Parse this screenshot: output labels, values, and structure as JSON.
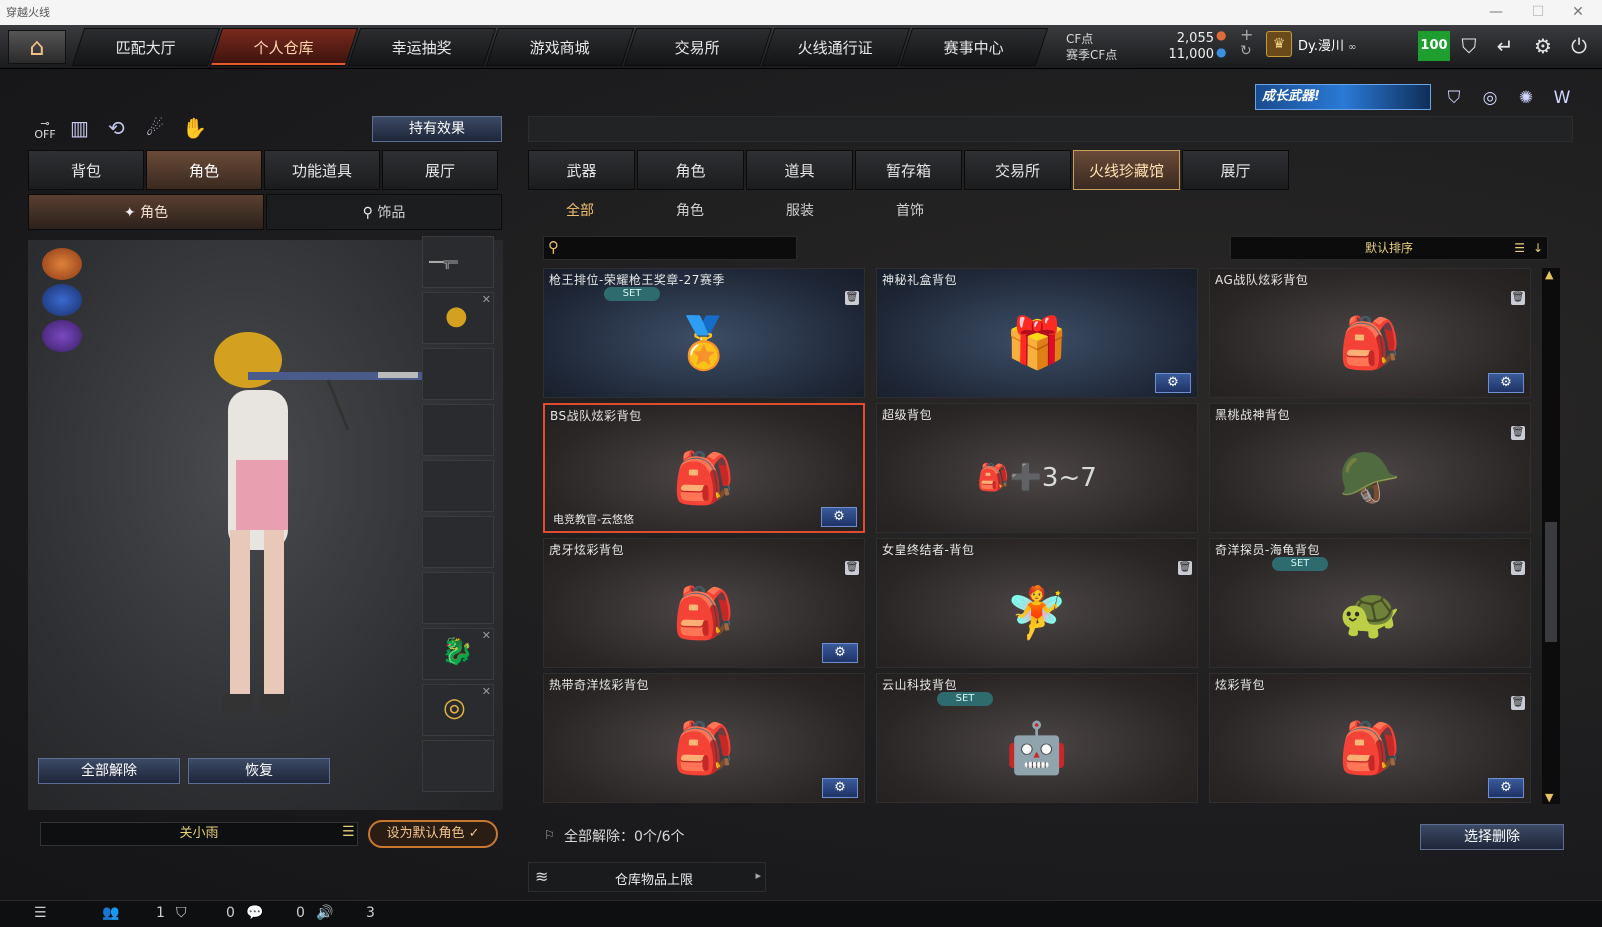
{
  "window": {
    "title": "穿越火线"
  },
  "nav": {
    "tabs": [
      "匹配大厅",
      "个人仓库",
      "幸运抽奖",
      "游戏商城",
      "交易所",
      "火线通行证",
      "赛事中心"
    ],
    "active": 1
  },
  "currency": {
    "cf_label": "CF点",
    "cf_value": "2,055",
    "season_label": "赛季CF点",
    "season_value": "11,000"
  },
  "user": {
    "name": "Dy.漫川",
    "level": "100"
  },
  "banner": {
    "text": "成长武器!"
  },
  "left": {
    "effect_button": "持有效果",
    "tabs": [
      "背包",
      "角色",
      "功能道具",
      "展厅"
    ],
    "active_tab": 1,
    "subtabs": [
      "角色",
      "饰品"
    ],
    "active_subtab": 0,
    "release_all": "全部解除",
    "restore": "恢复",
    "character_name": "关小雨",
    "set_default": "设为默认角色"
  },
  "right": {
    "tabs": [
      "武器",
      "角色",
      "道具",
      "暂存箱",
      "交易所",
      "火线珍藏馆",
      "展厅"
    ],
    "active_tab": 5,
    "filters": [
      "全部",
      "角色",
      "服装",
      "首饰"
    ],
    "active_filter": 0,
    "search": {
      "placeholder": ""
    },
    "sort": "默认排序",
    "items": [
      {
        "name": "枪王排位-荣耀枪王奖章-27赛季",
        "set": "SET",
        "trash": true,
        "gear": false,
        "style": "blue",
        "icon": "medal-icon",
        "glyph": "🏅"
      },
      {
        "name": "神秘礼盒背包",
        "set": "",
        "trash": false,
        "gear": true,
        "style": "blue",
        "icon": "gift-box-icon",
        "glyph": "🎁"
      },
      {
        "name": "AG战队炫彩背包",
        "set": "",
        "trash": true,
        "gear": true,
        "style": "",
        "icon": "red-backpack-icon",
        "glyph": "🎒"
      },
      {
        "name": "BS战队炫彩背包",
        "set": "",
        "trash": false,
        "gear": true,
        "style": "",
        "selected": true,
        "tag": "电竞教官-云悠悠",
        "icon": "dark-backpack-icon",
        "glyph": "🎒"
      },
      {
        "name": "超级背包",
        "set": "",
        "trash": false,
        "gear": false,
        "style": "",
        "icon": "super-backpack-icon",
        "glyph": "🎒➕3~7"
      },
      {
        "name": "黑桃战神背包",
        "set": "",
        "trash": true,
        "gear": false,
        "style": "",
        "icon": "soldier-figure-icon",
        "glyph": "🪖"
      },
      {
        "name": "虎牙炫彩背包",
        "set": "",
        "trash": true,
        "gear": true,
        "style": "",
        "icon": "huya-backpack-icon",
        "glyph": "🎒"
      },
      {
        "name": "女皇终结者-背包",
        "set": "",
        "trash": true,
        "gear": false,
        "style": "",
        "icon": "queen-figure-icon",
        "glyph": "🧚"
      },
      {
        "name": "奇洋探员-海龟背包",
        "set": "SET",
        "trash": true,
        "gear": false,
        "style": "",
        "icon": "sea-turtle-icon",
        "glyph": "🐢"
      },
      {
        "name": "热带奇洋炫彩背包",
        "set": "",
        "trash": false,
        "gear": true,
        "style": "",
        "icon": "tropical-backpack-icon",
        "glyph": "🎒"
      },
      {
        "name": "云山科技背包",
        "set": "SET",
        "trash": false,
        "gear": false,
        "style": "",
        "icon": "tech-backpack-icon",
        "glyph": "🤖"
      },
      {
        "name": "炫彩背包",
        "set": "",
        "trash": true,
        "gear": true,
        "style": "",
        "icon": "military-backpack-icon",
        "glyph": "🎒"
      }
    ],
    "release_status": "全部解除：0个/6个",
    "select_delete": "选择删除",
    "warehouse_limit": "仓库物品上限"
  },
  "footer": {
    "friends": "1",
    "clan": "0",
    "chat": "0",
    "volume": "3"
  },
  "colors": {
    "accent": "#e14b2e",
    "level": "#1e9e2e",
    "gold": "#e8d07a"
  }
}
